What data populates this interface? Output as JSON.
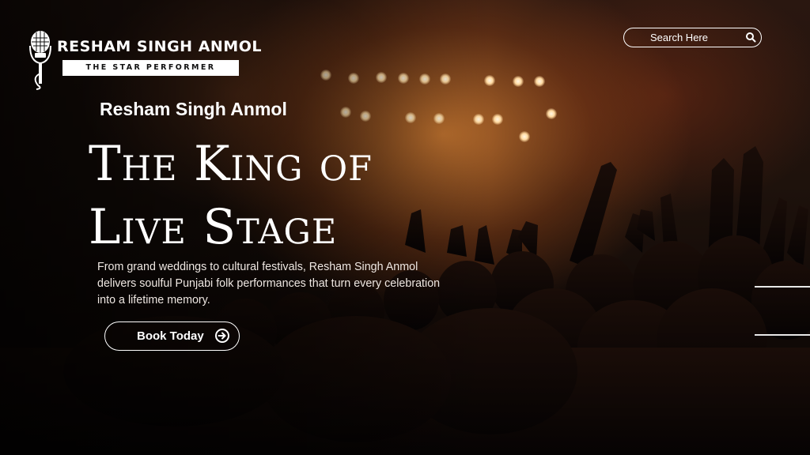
{
  "brand": {
    "name": "RESHAM SINGH ANMOL",
    "tagline": "THE STAR PERFORMER",
    "logo_icon": "microphone-icon"
  },
  "search": {
    "placeholder": "Search Here",
    "icon": "search-icon"
  },
  "hero": {
    "eyebrow": "Resham Singh Anmol",
    "headline_line1": "The King of",
    "headline_line2": "Live Stage",
    "description": "From grand weddings to cultural festivals, Resham Singh Anmol delivers soulful Punjabi folk performances that turn every celebration into a lifetime memory."
  },
  "cta": {
    "label": "Book Today",
    "icon": "arrow-right-circle-icon"
  },
  "colors": {
    "text": "#ffffff",
    "glow": "#d68034",
    "background": "#120a07"
  }
}
